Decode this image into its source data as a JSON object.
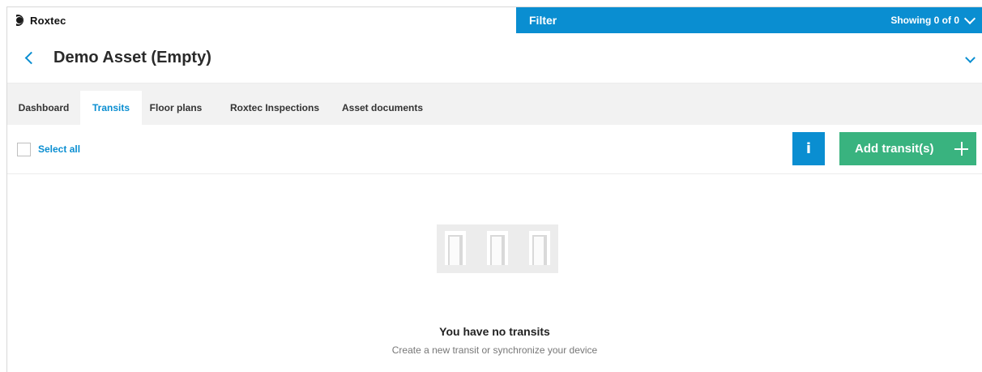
{
  "brand": {
    "name": "Roxtec"
  },
  "filter_bar": {
    "label": "Filter",
    "showing": "Showing 0 of 0"
  },
  "page": {
    "title": "Demo Asset (Empty)"
  },
  "tabs": [
    {
      "label": "Dashboard",
      "active": false
    },
    {
      "label": "Transits",
      "active": true
    },
    {
      "label": "Floor plans",
      "active": false
    },
    {
      "label": "Roxtec Inspections",
      "active": false
    },
    {
      "label": "Asset documents",
      "active": false
    }
  ],
  "toolbar": {
    "select_all_label": "Select all",
    "info_label": "i",
    "add_label": "Add transit(s)"
  },
  "empty_state": {
    "title": "You have no transits",
    "subtitle": "Create a new transit or synchronize your device"
  },
  "colors": {
    "accent": "#0a8ed1",
    "add_button": "#39b37f",
    "tab_bar": "#f2f2f2"
  },
  "icons": [
    "roxtec-logo-icon",
    "chevron-down-icon",
    "back-arrow-icon",
    "checkbox-icon",
    "info-icon",
    "plus-icon",
    "transit-frames-illustration"
  ]
}
